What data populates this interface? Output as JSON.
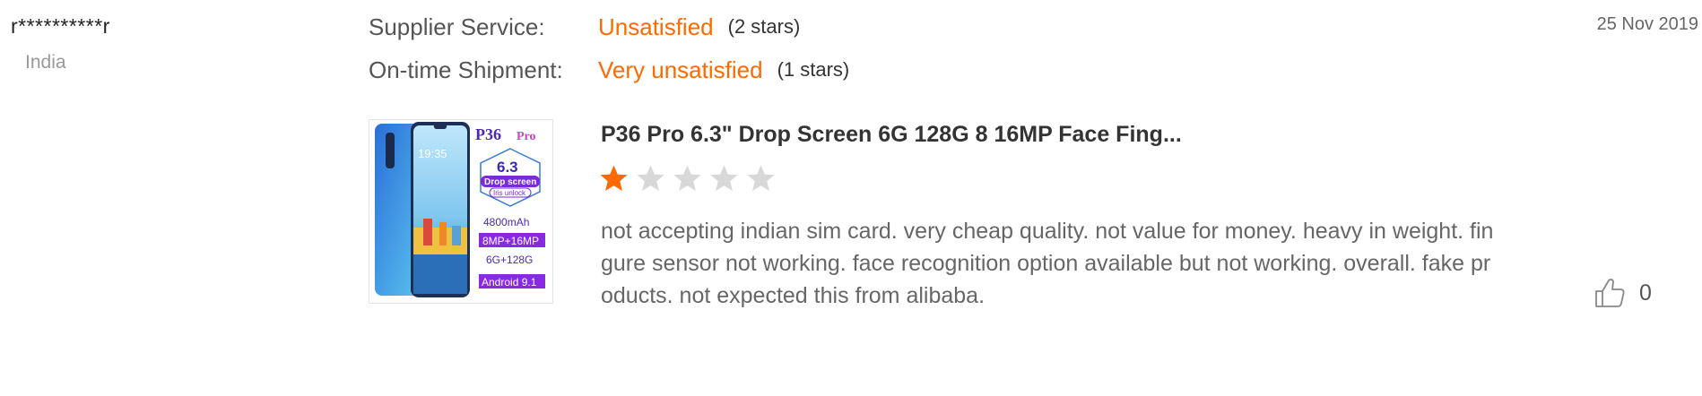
{
  "reviewer": {
    "name": "r**********r",
    "country": "India"
  },
  "ratings": [
    {
      "label": "Supplier Service:",
      "value": "Unsatisfied",
      "stars_text": "(2 stars)"
    },
    {
      "label": "On-time Shipment:",
      "value": "Very unsatisfied",
      "stars_text": "(1 stars)"
    }
  ],
  "review": {
    "date": "25 Nov 2019",
    "product_title": "P36 Pro 6.3\" Drop Screen 6G 128G 8 16MP Face Fing...",
    "star_rating": 1,
    "star_max": 5,
    "text": "not accepting indian sim card. very cheap quality. not value for money. heavy in weight. fingure sensor not working. face recognition option available but not working. overall. fake products. not expected this from alibaba.",
    "likes": "0"
  },
  "product_image": {
    "model_label": "P36",
    "pro_label": "Pro",
    "clock": "19:35",
    "screen_size": "6.3",
    "drop_screen": "Drop screen",
    "iris": "Iris unlock",
    "battery": "4800mAh",
    "camera": "8MP+16MP",
    "memory": "6G+128G",
    "os": "Android 9.1"
  },
  "colors": {
    "accent": "#ff6a00",
    "star_active": "#ff6a00",
    "star_inactive": "#d8d8d8"
  },
  "icons": {
    "star": "star-icon",
    "like": "thumbs-up-icon"
  }
}
